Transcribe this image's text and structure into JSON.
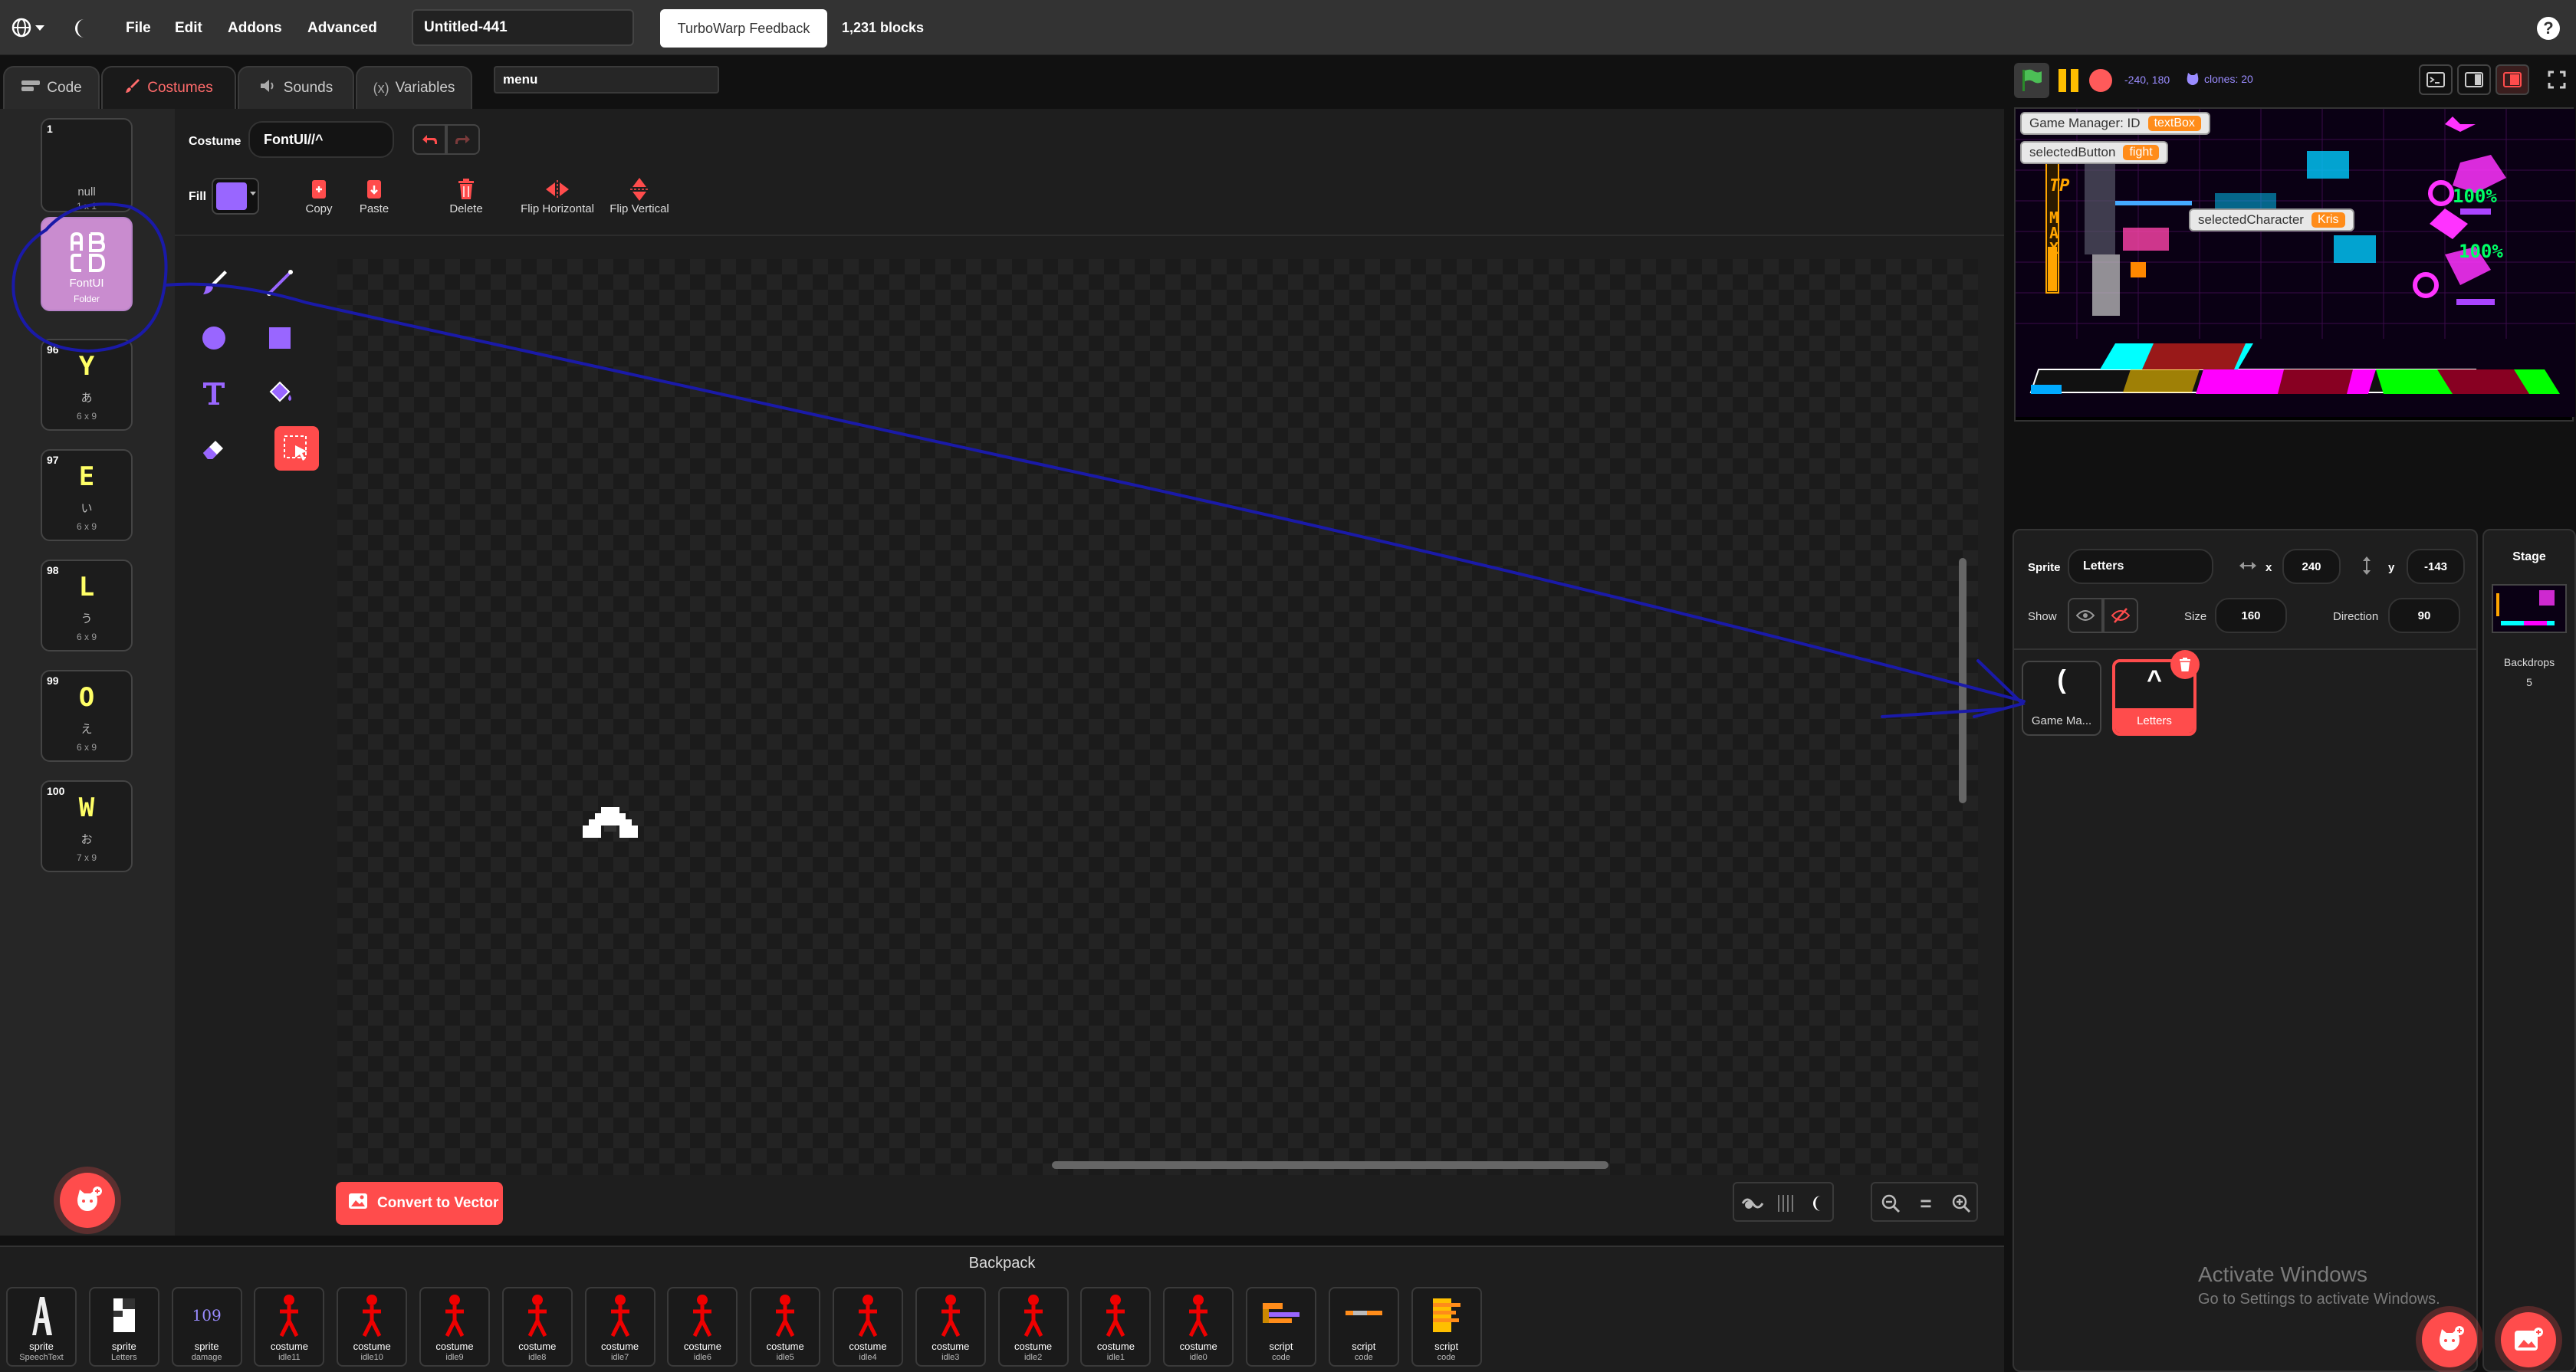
{
  "menubar": {
    "file": "File",
    "edit": "Edit",
    "addons": "Addons",
    "advanced": "Advanced",
    "project_title": "Untitled-441",
    "feedback_button": "TurboWarp Feedback",
    "block_count": "1,231 blocks",
    "help": "?"
  },
  "tabs": {
    "code": "Code",
    "costumes": "Costumes",
    "sounds": "Sounds",
    "variables": "Variables",
    "search_value": "menu"
  },
  "costumes": [
    {
      "num": "1",
      "glyph": "",
      "name": "null",
      "size": "1 x 1"
    },
    {
      "num": "",
      "glyph": "AB\nCD",
      "name": "FontUI",
      "size": "Folder"
    },
    {
      "num": "96",
      "glyph": "Y",
      "name": "あ",
      "size": "6 x 9"
    },
    {
      "num": "97",
      "glyph": "E",
      "name": "い",
      "size": "6 x 9"
    },
    {
      "num": "98",
      "glyph": "L",
      "name": "う",
      "size": "6 x 9"
    },
    {
      "num": "99",
      "glyph": "O",
      "name": "え",
      "size": "6 x 9"
    },
    {
      "num": "100",
      "glyph": "W",
      "name": "お",
      "size": "7 x 9"
    }
  ],
  "editor": {
    "costume_label": "Costume",
    "costume_name": "FontUI//^",
    "fill_label": "Fill",
    "fill_color": "#9966ff",
    "copy": "Copy",
    "paste": "Paste",
    "delete": "Delete",
    "flip_horizontal": "Flip Horizontal",
    "flip_vertical": "Flip Vertical",
    "convert": "Convert to Vector",
    "zoom_reset": "="
  },
  "stage": {
    "coords": "-240, 180",
    "clones": "clones: 20",
    "monitors": [
      {
        "label": "Game Manager: ID",
        "value": "textBox"
      },
      {
        "label": "selectedButton",
        "value": "fight"
      },
      {
        "label": "selectedCharacter",
        "value": "Kris"
      }
    ],
    "game_text": {
      "tp": "TP",
      "max": "MAX",
      "pct1": "100%",
      "pct2": "100%"
    }
  },
  "sprite_info": {
    "sprite_label": "Sprite",
    "sprite_name": "Letters",
    "x_label": "x",
    "x_value": "240",
    "y_label": "y",
    "y_value": "-143",
    "show_label": "Show",
    "size_label": "Size",
    "size_value": "160",
    "direction_label": "Direction",
    "direction_value": "90",
    "sprites": [
      {
        "name": "Game Ma...",
        "glyph": "("
      },
      {
        "name": "Letters",
        "glyph": "^"
      }
    ]
  },
  "stage_selector": {
    "title": "Stage",
    "backdrops_label": "Backdrops",
    "backdrops_count": "5"
  },
  "backpack": {
    "title": "Backpack",
    "items": [
      {
        "t1": "sprite",
        "t2": "SpeechText",
        "kind": "sprite-a"
      },
      {
        "t1": "sprite",
        "t2": "Letters",
        "kind": "sprite-b"
      },
      {
        "t1": "sprite",
        "t2": "damage",
        "kind": "num",
        "label": "109"
      },
      {
        "t1": "costume",
        "t2": "idle11",
        "kind": "stick"
      },
      {
        "t1": "costume",
        "t2": "idle10",
        "kind": "stick"
      },
      {
        "t1": "costume",
        "t2": "idle9",
        "kind": "stick"
      },
      {
        "t1": "costume",
        "t2": "idle8",
        "kind": "stick"
      },
      {
        "t1": "costume",
        "t2": "idle7",
        "kind": "stick"
      },
      {
        "t1": "costume",
        "t2": "idle6",
        "kind": "stick"
      },
      {
        "t1": "costume",
        "t2": "idle5",
        "kind": "stick"
      },
      {
        "t1": "costume",
        "t2": "idle4",
        "kind": "stick"
      },
      {
        "t1": "costume",
        "t2": "idle3",
        "kind": "stick"
      },
      {
        "t1": "costume",
        "t2": "idle2",
        "kind": "stick"
      },
      {
        "t1": "costume",
        "t2": "idle1",
        "kind": "stick"
      },
      {
        "t1": "costume",
        "t2": "idle0",
        "kind": "stick"
      },
      {
        "t1": "script",
        "t2": "code",
        "kind": "script"
      },
      {
        "t1": "script",
        "t2": "code",
        "kind": "script2"
      },
      {
        "t1": "script",
        "t2": "code",
        "kind": "script3"
      }
    ]
  },
  "watermark": {
    "line1": "Activate Windows",
    "line2": "Go to Settings to activate Windows."
  },
  "colors": {
    "accent": "#ff4c4c",
    "annotation": "#1a1aa8"
  }
}
